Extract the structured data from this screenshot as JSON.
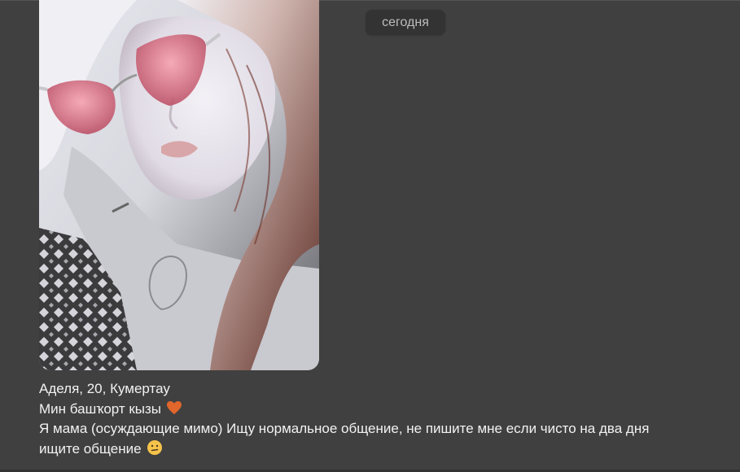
{
  "chat": {
    "date_label": "сегодня"
  },
  "message": {
    "photo": {
      "alt_name": "profile-photo"
    },
    "lines": [
      "Аделя, 20, Кумертау",
      "Мин башҡорт кызы",
      "Я мама (осуждающие мимо) Ищу нормальное общение, не пишите мне если чисто на два дня",
      "ищите общение"
    ],
    "emoji": {
      "heart": "heart-emoji",
      "confused": "confused-face-emoji"
    }
  },
  "colors": {
    "background": "#404040",
    "badge_bg": "#333333",
    "badge_text": "#bdbdbd",
    "text": "#f2f2f2",
    "heart": "#e0662b",
    "confused": "#f6c34a"
  }
}
